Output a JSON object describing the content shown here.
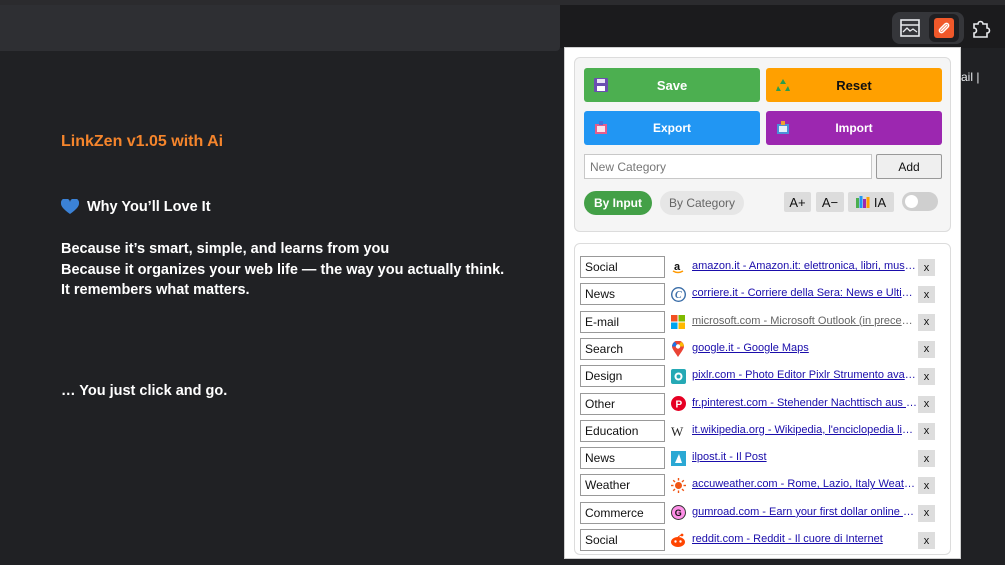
{
  "page": {
    "title": "LinkZen  v1.05  with Ai",
    "subtitle": "Why You’ll Love It",
    "lines": [
      "Because it’s smart, simple, and learns from you",
      "Because it organizes your web life — the way you actually think.",
      "It remembers what matters."
    ],
    "tagline": "… You just click and go.",
    "right_cut_text": "ail   |   "
  },
  "toolbar": {
    "icons": [
      "side-panel-icon",
      "linkzen-extension-icon",
      "extensions-puzzle-icon"
    ]
  },
  "popup": {
    "save_label": "Save",
    "reset_label": "Reset",
    "export_label": "Export",
    "import_label": "Import",
    "category_placeholder": "New Category",
    "add_label": "Add",
    "by_input_label": "By Input",
    "by_category_label": "By Category",
    "font_increase_label": "A+",
    "font_decrease_label": "A−",
    "ia_label": "IA",
    "toggle_on": false,
    "colors": {
      "save": "#4caf50",
      "reset": "#ffa000",
      "export": "#2196f3",
      "import": "#9c27b0",
      "title_orange": "#f5852c"
    }
  },
  "links": [
    {
      "category": "Social",
      "icon": "amazon-icon",
      "text": "amazon.it - Amazon.it: elettronica, libri, musica, fashion"
    },
    {
      "category": "News",
      "icon": "corriere-icon",
      "text": "corriere.it - Corriere della Sera: News e Ultime notizie"
    },
    {
      "category": "E-mail",
      "icon": "microsoft-icon",
      "text": "microsoft.com - Microsoft Outlook (in precedenza Hotmail)",
      "visited": true
    },
    {
      "category": "Search",
      "icon": "google-maps-icon",
      "text": "google.it - Google Maps"
    },
    {
      "category": "Design",
      "icon": "pixlr-icon",
      "text": "pixlr.com - Photo Editor Pixlr Strumento avanzato"
    },
    {
      "category": "Other",
      "icon": "pinterest-icon",
      "text": "fr.pinterest.com - Stehender Nachttisch aus Massivholz"
    },
    {
      "category": "Education",
      "icon": "wikipedia-icon",
      "text": "it.wikipedia.org - Wikipedia, l'enciclopedia libera"
    },
    {
      "category": "News",
      "icon": "ilpost-icon",
      "text": "ilpost.it - Il Post"
    },
    {
      "category": "Weather",
      "icon": "accuweather-icon",
      "text": "accuweather.com - Rome, Lazio, Italy Weather Forecast"
    },
    {
      "category": "Commerce",
      "icon": "gumroad-icon",
      "text": "gumroad.com - Earn your first dollar online with Gumroad"
    },
    {
      "category": "Social",
      "icon": "reddit-icon",
      "text": "reddit.com - Reddit - Il cuore di Internet"
    }
  ],
  "delete_label": "x"
}
